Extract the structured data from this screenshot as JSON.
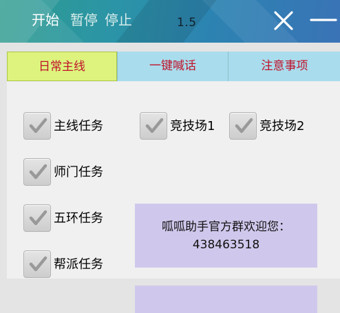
{
  "toolbar": {
    "start_label": "开始",
    "pause_label": "暂停",
    "stop_label": "停止",
    "version": "1.5",
    "close_icon": "close-icon",
    "minimize_icon": "minimize-icon"
  },
  "tabs": [
    {
      "label": "日常主线",
      "selected": true
    },
    {
      "label": "一键喊话",
      "selected": false
    },
    {
      "label": "注意事项",
      "selected": false
    }
  ],
  "tasks": [
    {
      "label": "主线任务",
      "checked": true
    },
    {
      "label": "竞技场1",
      "checked": true
    },
    {
      "label": "竞技场2",
      "checked": true
    },
    {
      "label": "师门任务",
      "checked": true
    },
    {
      "label": "五环任务",
      "checked": true
    },
    {
      "label": "帮派任务",
      "checked": true
    }
  ],
  "notice": {
    "line1": "呱呱助手官方群欢迎您：",
    "line2": "438463518"
  },
  "colors": {
    "active_tab": "#ddf37d",
    "inactive_tab": "#a9dcec",
    "tab_text": "#c0122a",
    "notice_bg": "#d0c8ec"
  }
}
